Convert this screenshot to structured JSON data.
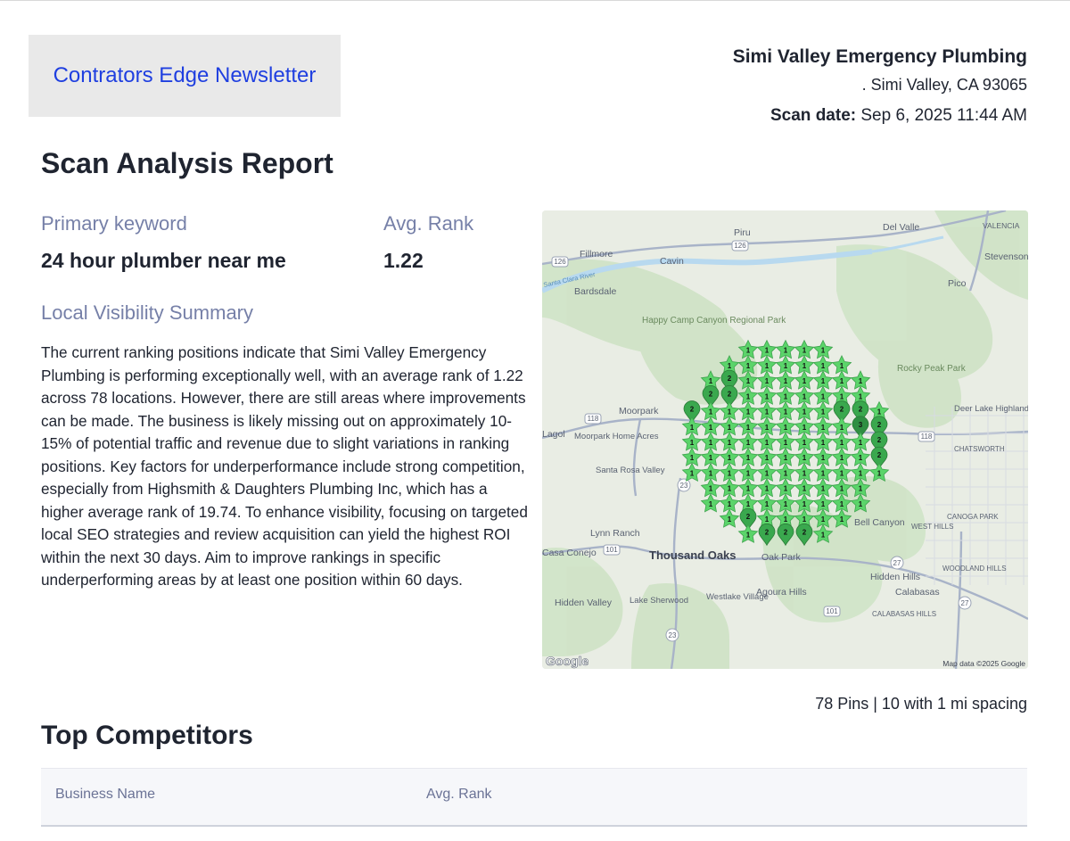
{
  "newsletter": {
    "title": "Contrators Edge Newsletter"
  },
  "business": {
    "name": "Simi Valley Emergency Plumbing",
    "address": ". Simi Valley, CA 93065",
    "scan_label": "Scan date:",
    "scan_value": "Sep 6, 2025 11:44 AM"
  },
  "report": {
    "title": "Scan Analysis Report",
    "primary_keyword_label": "Primary keyword",
    "primary_keyword": "24 hour plumber near me",
    "avg_rank_label": "Avg. Rank",
    "avg_rank": "1.22",
    "visibility_label": "Local Visibility Summary",
    "summary": "The current ranking positions indicate that Simi Valley Emergency Plumbing is performing exceptionally well, with an average rank of 1.22 across 78 locations. However, there are still areas where improvements can be made. The business is likely missing out on approximately 10-15% of potential traffic and revenue due to slight variations in ranking positions. Key factors for underperformance include strong competition, especially from Highsmith & Daughters Plumbing Inc, which has a higher average rank of 19.74. To enhance visibility, focusing on targeted local SEO strategies and review acquisition can yield the highest ROI within the next 30 days. Aim to improve rankings in specific underperforming areas by at least one position within 60 days."
  },
  "map": {
    "pins_caption": "78 Pins | 10 with 1 mi spacing",
    "attribution": "Map data ©2025 Google",
    "google_logo": "Google",
    "pin_colors": {
      "rank1": "#5bd46a",
      "rank2": "#3aa84e",
      "rank3": "#2e8f42"
    },
    "labels": {
      "piru": "Piru",
      "delvalle": "Del Valle",
      "valencia": "VALENCIA",
      "fillmore": "Fillmore",
      "cavin": "Cavin",
      "stevenson": "Stevenson Ranch",
      "bardsdale": "Bardsdale",
      "pico": "Pico",
      "santaclara": "Santa Clara River",
      "happycamp": "Happy Camp Canyon Regional Park",
      "rocky": "Rocky Peak Park",
      "deerlake": "Deer Lake Highlands",
      "moorpark": "Moorpark",
      "lagol": "Lagol",
      "moorparkhome": "Moorpark Home Acres",
      "chatsworth": "CHATSWORTH",
      "santarosa": "Santa Rosa Valley",
      "bellcanyon": "Bell Canyon",
      "canogapark": "CANOGA PARK",
      "westhills": "WEST HILLS",
      "lynnranch": "Lynn Ranch",
      "casaconejo": "Casa Conejo",
      "thousandoaks": "Thousand Oaks",
      "oakpark": "Oak Park",
      "hiddenhills": "Hidden Hills",
      "woodland": "WOODLAND HILLS",
      "calabasas": "Calabasas",
      "hiddenvalley": "Hidden Valley",
      "lakesherwood": "Lake Sherwood",
      "westlake": "Westlake Village",
      "agoura": "Agoura Hills",
      "calabasashills": "CALABASAS HILLS",
      "r126a": "126",
      "r126b": "126",
      "r118a": "118",
      "r118b": "118",
      "r23a": "23",
      "r23b": "23",
      "r101a": "101",
      "r101b": "101",
      "r27a": "27",
      "r27b": "27"
    }
  },
  "competitors": {
    "title": "Top Competitors",
    "col_name": "Business Name",
    "col_rank": "Avg. Rank"
  }
}
